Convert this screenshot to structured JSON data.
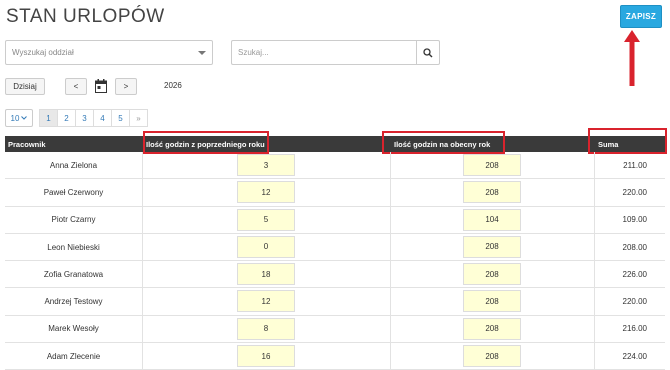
{
  "page": {
    "title": "STAN URLOPÓW"
  },
  "toolbar": {
    "save_label": "ZAPISZ"
  },
  "filters": {
    "department_placeholder": "Wyszukaj oddział",
    "search_placeholder": "Szukaj..."
  },
  "date_nav": {
    "today_label": "Dzisiaj",
    "prev_label": "<",
    "next_label": ">",
    "year": "2026"
  },
  "pagination": {
    "page_size": "10",
    "pages": [
      "1",
      "2",
      "3",
      "4",
      "5"
    ],
    "more_label": "»",
    "active_page": "1"
  },
  "table": {
    "headers": {
      "employee": "Pracownik",
      "prev_year_hours": "Ilość godzin z poprzedniego roku",
      "current_year_hours": "Ilość godzin na obecny rok",
      "sum": "Suma"
    },
    "rows": [
      {
        "name": "Anna Zielona",
        "prev": "3",
        "cur": "208",
        "sum": "211.00"
      },
      {
        "name": "Paweł Czerwony",
        "prev": "12",
        "cur": "208",
        "sum": "220.00"
      },
      {
        "name": "Piotr Czarny",
        "prev": "5",
        "cur": "104",
        "sum": "109.00"
      },
      {
        "name": "Leon Niebieski",
        "prev": "0",
        "cur": "208",
        "sum": "208.00"
      },
      {
        "name": "Zofia Granatowa",
        "prev": "18",
        "cur": "208",
        "sum": "226.00"
      },
      {
        "name": "Andrzej Testowy",
        "prev": "12",
        "cur": "208",
        "sum": "220.00"
      },
      {
        "name": "Marek Wesoły",
        "prev": "8",
        "cur": "208",
        "sum": "216.00"
      },
      {
        "name": "Adam Zlecenie",
        "prev": "16",
        "cur": "208",
        "sum": "224.00"
      }
    ]
  },
  "colors": {
    "accent": "#29a8e0",
    "highlight": "#d9232d",
    "header_bg": "#3a3a3a",
    "input_bg": "#ffffd6"
  }
}
